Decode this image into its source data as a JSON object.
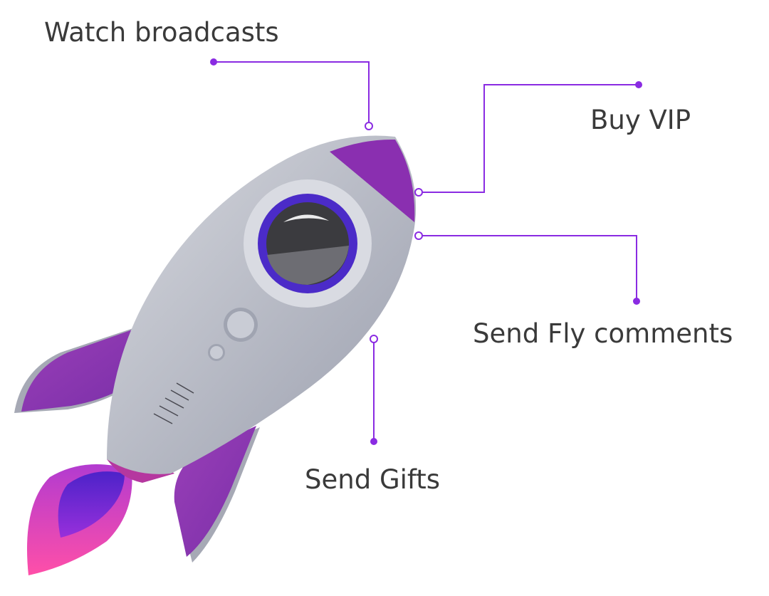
{
  "labels": {
    "watch_broadcasts": "Watch broadcasts",
    "buy_vip": "Buy VIP",
    "send_fly_comments": "Send Fly comments",
    "send_gifts": "Send Gifts"
  },
  "colors": {
    "connector": "#8a2be2",
    "label_text": "#3a3a3a",
    "rocket_body": "#b8bcc8",
    "rocket_accent": "#8a2fb0",
    "porthole_ring": "#4b2bc8",
    "flame": "#ff4fa8"
  },
  "icons": {
    "rocket": "rocket-illustration"
  }
}
